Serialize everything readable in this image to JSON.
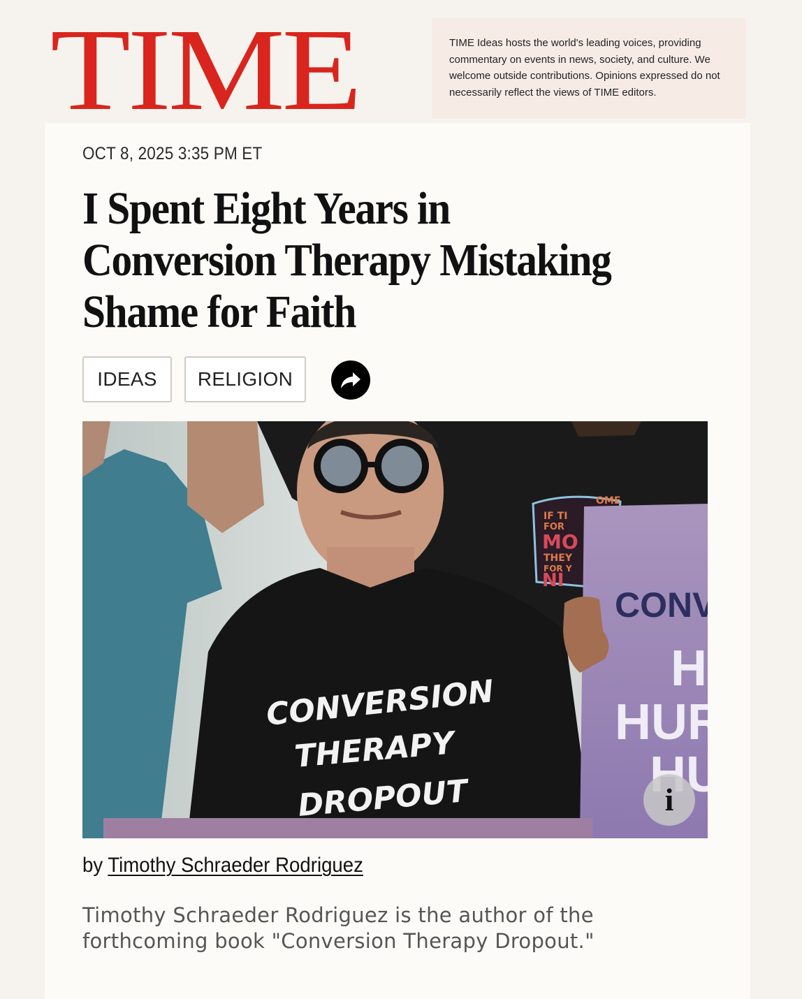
{
  "brand": {
    "logo_text": "TIME",
    "logo_color": "#d9251d"
  },
  "ideas_note": "TIME Ideas hosts the world's leading voices, providing commentary on events in news, society, and culture. We welcome outside contributions. Opinions expressed do not necessarily reflect the views of TIME editors.",
  "article": {
    "dateline": "OCT 8, 2025 3:35 PM ET",
    "headline": "I Spent Eight Years in Conversion Therapy Mistaking Shame for Faith",
    "tags": [
      "IDEAS",
      "RELIGION"
    ],
    "share_icon": "share-arrow-icon",
    "image": {
      "shirt_text": [
        "CONVERSION",
        "THERAPY",
        "DROPOUT"
      ],
      "sign_text": [
        "CONV",
        "H",
        "HUR",
        "HU"
      ],
      "background_shirt_text": [
        "IF TI",
        "OME",
        "FOR",
        "MO",
        "THEY",
        "FOR Y",
        "NI"
      ],
      "info_label": "i"
    },
    "byline_prefix": "by",
    "author": "Timothy Schraeder Rodriguez",
    "bio": "Timothy Schraeder Rodriguez is the author of the forthcoming book \"Conversion Therapy Dropout.\""
  }
}
